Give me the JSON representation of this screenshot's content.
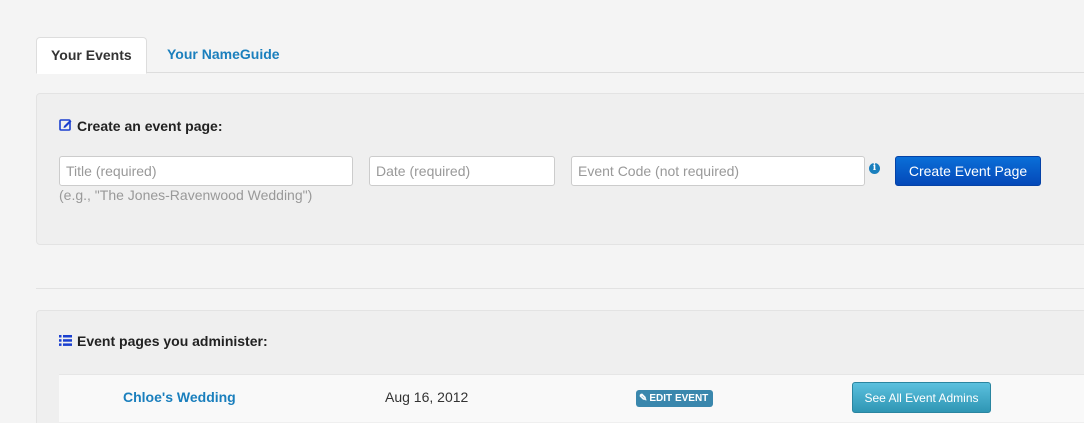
{
  "tabs": [
    {
      "label": "Your Events",
      "active": true
    },
    {
      "label": "Your NameGuide",
      "active": false
    }
  ],
  "create": {
    "heading": "Create an event page:",
    "title_placeholder": "Title (required)",
    "date_placeholder": "Date (required)",
    "code_placeholder": "Event Code (not required)",
    "hint": "(e.g., \"The Jones-Ravenwood Wedding\")",
    "info_icon": "i",
    "button_label": "Create Event Page"
  },
  "list": {
    "heading": "Event pages you administer:",
    "events": [
      {
        "name": "Chloe's Wedding",
        "date": "Aug 16, 2012",
        "edit_label": "EDIT EVENT",
        "admins_label": "See All Event Admins"
      }
    ]
  },
  "colors": {
    "link": "#1a7fbd",
    "primary_button": "#0a5fcf",
    "info_button": "#49afcd",
    "badge": "#3a87ad"
  }
}
